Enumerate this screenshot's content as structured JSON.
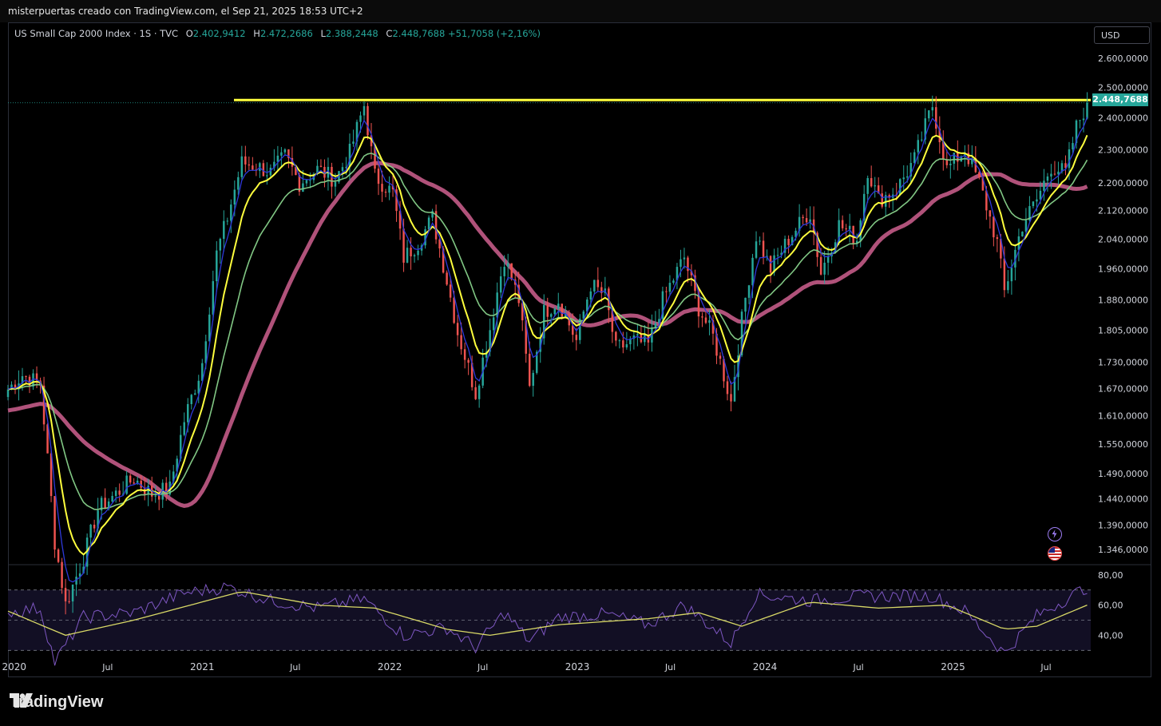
{
  "header": {
    "caption": "misterpuertas creado con TradingView.com, el Sep 21, 2025 18:53 UTC+2"
  },
  "legend": {
    "symbol": "US Small Cap 2000 Index · 1S · TVC",
    "o_label": "O",
    "o_value": "2.402,9412",
    "h_label": "H",
    "h_value": "2.472,2686",
    "l_label": "L",
    "l_value": "2.388,2448",
    "c_label": "C",
    "c_value": "2.448,7688",
    "change": "+51,7058 (+2,16%)"
  },
  "currency_button": "USD",
  "last_price": "2.448,7688",
  "brand": {
    "name": "TradingView",
    "logo_icon": "tradingview-logo-icon"
  },
  "icons": [
    "lightning-icon",
    "us-flag-icon"
  ],
  "colors": {
    "up": "#26a69a",
    "down": "#ef5350",
    "ema_fast": "#2e39d9",
    "ema_mid": "#ffff3d",
    "ema_slow": "#81c784",
    "sma_long": "#b0527a",
    "resistance": "#ffff3d",
    "rsi": "#7e57c2",
    "rsi_ma": "#d8d866"
  },
  "chart_data": [
    {
      "type": "candlestick",
      "title": "US Small Cap 2000 Index · 1S · TVC",
      "timeframe": "1 week",
      "y_scale": "log",
      "ylim": [
        1320,
        2650
      ],
      "y_ticks": [
        {
          "value": 2600,
          "label": "2.600,0000"
        },
        {
          "value": 2500,
          "label": "2.500,0000"
        },
        {
          "value": 2400,
          "label": "2.400,0000"
        },
        {
          "value": 2300,
          "label": "2.300,0000"
        },
        {
          "value": 2200,
          "label": "2.200,0000"
        },
        {
          "value": 2120,
          "label": "2.120,0000"
        },
        {
          "value": 2040,
          "label": "2.040,0000"
        },
        {
          "value": 1960,
          "label": "1.960,0000"
        },
        {
          "value": 1880,
          "label": "1.880,0000"
        },
        {
          "value": 1805,
          "label": "1.805,0000"
        },
        {
          "value": 1730,
          "label": "1.730,0000"
        },
        {
          "value": 1670,
          "label": "1.670,0000"
        },
        {
          "value": 1610,
          "label": "1.610,0000"
        },
        {
          "value": 1550,
          "label": "1.550,0000"
        },
        {
          "value": 1490,
          "label": "1.490,0000"
        },
        {
          "value": 1440,
          "label": "1.440,0000"
        },
        {
          "value": 1390,
          "label": "1.390,0000"
        },
        {
          "value": 1346,
          "label": "1.346,0000"
        }
      ],
      "x_ticks": [
        {
          "date": "2020-01-01",
          "label": "2020"
        },
        {
          "date": "2020-07-01",
          "label": "Jul"
        },
        {
          "date": "2021-01-01",
          "label": "2021"
        },
        {
          "date": "2021-07-01",
          "label": "Jul"
        },
        {
          "date": "2022-01-01",
          "label": "2022"
        },
        {
          "date": "2022-07-01",
          "label": "Jul"
        },
        {
          "date": "2023-01-01",
          "label": "2023"
        },
        {
          "date": "2023-07-01",
          "label": "Jul"
        },
        {
          "date": "2024-01-01",
          "label": "2024"
        },
        {
          "date": "2024-07-01",
          "label": "Jul"
        },
        {
          "date": "2025-01-01",
          "label": "2025"
        },
        {
          "date": "2025-07-01",
          "label": "Jul"
        }
      ],
      "close_path": [
        [
          "2019-12-20",
          1668
        ],
        [
          "2020-01-17",
          1700
        ],
        [
          "2020-02-21",
          1680
        ],
        [
          "2020-03-20",
          1360
        ],
        [
          "2020-04-10",
          1250
        ],
        [
          "2020-05-15",
          1330
        ],
        [
          "2020-06-12",
          1420
        ],
        [
          "2020-07-17",
          1450
        ],
        [
          "2020-08-21",
          1480
        ],
        [
          "2020-09-25",
          1450
        ],
        [
          "2020-10-30",
          1460
        ],
        [
          "2020-11-27",
          1600
        ],
        [
          "2020-12-31",
          1720
        ],
        [
          "2021-01-29",
          2000
        ],
        [
          "2021-02-19",
          2100
        ],
        [
          "2021-03-19",
          2260
        ],
        [
          "2021-04-16",
          2250
        ],
        [
          "2021-05-14",
          2230
        ],
        [
          "2021-06-11",
          2280
        ],
        [
          "2021-07-09",
          2200
        ],
        [
          "2021-08-13",
          2240
        ],
        [
          "2021-09-17",
          2210
        ],
        [
          "2021-10-15",
          2290
        ],
        [
          "2021-11-12",
          2440
        ],
        [
          "2021-12-03",
          2220
        ],
        [
          "2022-01-07",
          2170
        ],
        [
          "2022-01-28",
          1990
        ],
        [
          "2022-02-25",
          2030
        ],
        [
          "2022-03-25",
          2100
        ],
        [
          "2022-04-22",
          1930
        ],
        [
          "2022-05-13",
          1800
        ],
        [
          "2022-06-17",
          1660
        ],
        [
          "2022-07-15",
          1810
        ],
        [
          "2022-08-12",
          1990
        ],
        [
          "2022-09-09",
          1880
        ],
        [
          "2022-09-30",
          1670
        ],
        [
          "2022-10-28",
          1850
        ],
        [
          "2022-11-25",
          1880
        ],
        [
          "2022-12-30",
          1780
        ],
        [
          "2023-01-27",
          1920
        ],
        [
          "2023-02-24",
          1890
        ],
        [
          "2023-03-17",
          1760
        ],
        [
          "2023-04-21",
          1780
        ],
        [
          "2023-05-19",
          1770
        ],
        [
          "2023-06-16",
          1880
        ],
        [
          "2023-07-28",
          1990
        ],
        [
          "2023-08-25",
          1860
        ],
        [
          "2023-09-22",
          1790
        ],
        [
          "2023-10-27",
          1640
        ],
        [
          "2023-11-17",
          1830
        ],
        [
          "2023-12-15",
          2050
        ],
        [
          "2024-01-12",
          1960
        ],
        [
          "2024-02-16",
          2040
        ],
        [
          "2024-03-28",
          2120
        ],
        [
          "2024-04-19",
          1950
        ],
        [
          "2024-05-24",
          2080
        ],
        [
          "2024-06-28",
          2040
        ],
        [
          "2024-07-19",
          2240
        ],
        [
          "2024-08-09",
          2150
        ],
        [
          "2024-09-13",
          2180
        ],
        [
          "2024-10-18",
          2270
        ],
        [
          "2024-11-22",
          2440
        ],
        [
          "2024-12-20",
          2240
        ],
        [
          "2025-01-24",
          2300
        ],
        [
          "2025-02-21",
          2200
        ],
        [
          "2025-03-28",
          2030
        ],
        [
          "2025-04-11",
          1900
        ],
        [
          "2025-05-16",
          2080
        ],
        [
          "2025-06-13",
          2150
        ],
        [
          "2025-07-11",
          2250
        ],
        [
          "2025-08-08",
          2230
        ],
        [
          "2025-08-29",
          2370
        ],
        [
          "2025-09-19",
          2449
        ]
      ],
      "overlays": [
        {
          "type": "moving-average",
          "role": "fast"
        },
        {
          "type": "moving-average",
          "role": "mid"
        },
        {
          "type": "moving-average",
          "role": "slow"
        },
        {
          "type": "moving-average",
          "role": "long"
        }
      ],
      "horizontal_line": {
        "value": 2458,
        "color": "#ffff3d"
      },
      "last_close": 2448.7688
    },
    {
      "type": "line",
      "indicator": "RSI",
      "ylim": [
        27,
        82
      ],
      "y_ticks": [
        {
          "value": 80,
          "label": "80,00"
        },
        {
          "value": 60,
          "label": "60,00"
        },
        {
          "value": 40,
          "label": "40,00"
        }
      ],
      "bands": [
        70,
        50,
        30
      ],
      "series": [
        {
          "values_path": [
            [
              "2019-12-20",
              55
            ],
            [
              "2020-02-21",
              58
            ],
            [
              "2020-03-20",
              22
            ],
            [
              "2020-05-15",
              52
            ],
            [
              "2020-08-21",
              55
            ],
            [
              "2020-11-27",
              68
            ],
            [
              "2021-02-19",
              72
            ],
            [
              "2021-05-14",
              63
            ],
            [
              "2021-08-13",
              58
            ],
            [
              "2021-11-12",
              64
            ],
            [
              "2022-01-28",
              40
            ],
            [
              "2022-04-22",
              45
            ],
            [
              "2022-06-17",
              32
            ],
            [
              "2022-08-12",
              55
            ],
            [
              "2022-09-30",
              36
            ],
            [
              "2022-11-25",
              52
            ],
            [
              "2023-02-24",
              54
            ],
            [
              "2023-05-19",
              47
            ],
            [
              "2023-07-28",
              60
            ],
            [
              "2023-10-27",
              35
            ],
            [
              "2023-12-15",
              67
            ],
            [
              "2024-03-28",
              63
            ],
            [
              "2024-07-19",
              66
            ],
            [
              "2024-11-22",
              66
            ],
            [
              "2025-01-24",
              56
            ],
            [
              "2025-04-11",
              28
            ],
            [
              "2025-06-13",
              53
            ],
            [
              "2025-09-19",
              72
            ]
          ]
        },
        {
          "role": "signal",
          "values_path": [
            [
              "2019-12-20",
              56
            ],
            [
              "2020-04-10",
              40
            ],
            [
              "2020-08-21",
              50
            ],
            [
              "2020-12-31",
              62
            ],
            [
              "2021-03-19",
              69
            ],
            [
              "2021-08-13",
              60
            ],
            [
              "2021-12-03",
              58
            ],
            [
              "2022-04-22",
              44
            ],
            [
              "2022-07-15",
              40
            ],
            [
              "2022-11-25",
              47
            ],
            [
              "2023-05-19",
              51
            ],
            [
              "2023-08-25",
              55
            ],
            [
              "2023-11-17",
              46
            ],
            [
              "2024-03-28",
              62
            ],
            [
              "2024-08-09",
              58
            ],
            [
              "2024-12-20",
              60
            ],
            [
              "2025-04-11",
              44
            ],
            [
              "2025-06-13",
              46
            ],
            [
              "2025-09-19",
              60
            ]
          ]
        }
      ]
    }
  ]
}
